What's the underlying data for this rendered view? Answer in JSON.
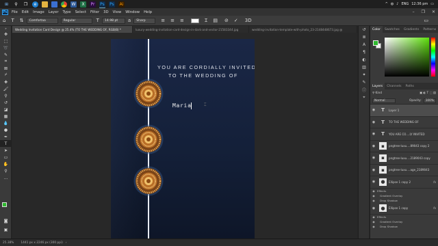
{
  "taskbar": {
    "icons": [
      "start-icon",
      "search-icon",
      "task-view-icon",
      "edge-icon",
      "explorer-icon",
      "store-icon",
      "chrome-icon",
      "word-icon",
      "excel-icon",
      "premiere-icon",
      "photoshop-icon",
      "photoshop-icon",
      "illustrator-icon"
    ],
    "language": "ENG",
    "time": "12:36 pm"
  },
  "menubar": {
    "logo": "Ps",
    "items": [
      "File",
      "Edit",
      "Image",
      "Layer",
      "Type",
      "Select",
      "Filter",
      "3D",
      "View",
      "Window",
      "Help"
    ]
  },
  "options": {
    "font_family": "Comfortaa",
    "font_style": "Regular",
    "font_size": "14.98 pt",
    "antialias": "Sharp",
    "text_color": "#ffffff"
  },
  "tabs": [
    {
      "label": "Wedding Invitation Card Design @ 25.4% (TO THE WEDDING OF, RGB/8) *",
      "active": true
    },
    {
      "label": "luxury-wedding-invitation-card-design-in-dark-and-vector-21583344.jpg",
      "active": false
    },
    {
      "label": "wedding-invitation-template-with-photo_23-2148448673.jpg @",
      "active": false
    }
  ],
  "canvas": {
    "line1": "YOU ARE CORDIALLY INVITED",
    "line2": "TO THE WEDDING OF",
    "typed": "Maria",
    "background_color": "#172440",
    "accent_color": "#c98b3c"
  },
  "panels": {
    "color_tabs": [
      "Color",
      "Swatches",
      "Gradients",
      "Patterns"
    ],
    "layer_tabs": [
      "Layers",
      "Channels",
      "Paths"
    ],
    "blend_mode": "Normal",
    "opacity_label": "Opacity:",
    "opacity_value": "100%",
    "foreground_color": "#2eb82e",
    "layers": [
      {
        "name": "Layer 1",
        "kind": "text",
        "selected": true,
        "fx": false
      },
      {
        "name": "TO THE WEDDING OF",
        "kind": "text",
        "selected": false,
        "fx": false
      },
      {
        "name": "YOU ARE CO....LY INVITED",
        "kind": "text",
        "selected": false,
        "fx": false
      },
      {
        "name": "pngtree-luxu....89043 copy 2",
        "kind": "image",
        "selected": false,
        "fx": false
      },
      {
        "name": "pngtree-luxu....2189043 copy",
        "kind": "image",
        "selected": false,
        "fx": false
      },
      {
        "name": "pngtree-luxu....age_2189043",
        "kind": "image",
        "selected": false,
        "fx": false
      },
      {
        "name": "Ellipse 1 copy 2",
        "kind": "shape",
        "selected": false,
        "fx": true,
        "effects": [
          "Effects",
          "Gradient Overlay",
          "Drop Shadow"
        ]
      },
      {
        "name": "Ellipse 1 copy",
        "kind": "shape",
        "selected": false,
        "fx": true,
        "effects": [
          "Effects",
          "Gradient Overlay",
          "Drop Shadow"
        ]
      }
    ]
  },
  "status": {
    "zoom": "25.38%",
    "doc_size": "1441 px x 2246 px (300 ppi)"
  }
}
